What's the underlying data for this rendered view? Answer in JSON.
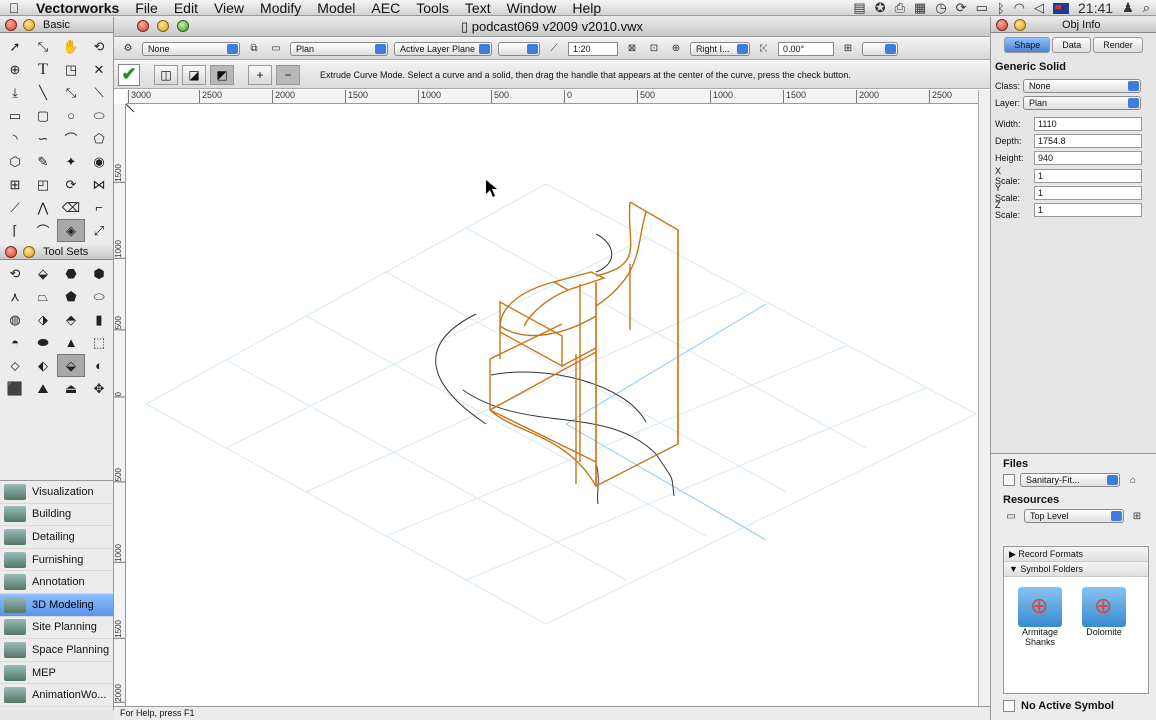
{
  "menubar": {
    "app_name": "Vectorworks",
    "menus": [
      "File",
      "Edit",
      "View",
      "Modify",
      "Model",
      "AEC",
      "Tools",
      "Text",
      "Window",
      "Help"
    ],
    "clock": "21:41"
  },
  "basic_palette": {
    "title": "Basic"
  },
  "toolsets_palette": {
    "title": "Tool Sets"
  },
  "tool_sets": [
    "Visualization",
    "Building",
    "Detailing",
    "Furnishing",
    "Annotation",
    "3D Modeling",
    "Site Planning",
    "Space Planning",
    "MEP",
    "AnimationWo..."
  ],
  "active_tool_set": "3D Modeling",
  "document": {
    "title": "podcast069 v2009 v2010.vwx",
    "class_popup": "None",
    "layer_popup": "Plan",
    "plane_popup": "Active Layer Plane",
    "scale": "1:20",
    "view_popup": "Right I...",
    "angle": "0.00°",
    "mode_hint": "Extrude Curve Mode. Select a curve and a solid, then drag the handle that appears at the center of the curve, press the check button.",
    "status": "For Help, press F1",
    "hruler_labels": [
      "3000",
      "2500",
      "2000",
      "1500",
      "1000",
      "500",
      "0",
      "500",
      "1000",
      "1500",
      "2000",
      "2500"
    ],
    "vruler_labels": [
      "1500",
      "1000",
      "500",
      "0",
      "500",
      "1000",
      "1500",
      "2000"
    ]
  },
  "obj_info": {
    "title": "Obj Info",
    "tabs": [
      "Shape",
      "Data",
      "Render"
    ],
    "object_type": "Generic Solid",
    "class_label": "Class:",
    "class_value": "None",
    "layer_label": "Layer:",
    "layer_value": "Plan",
    "width_label": "Width:",
    "width_value": "1110",
    "depth_label": "Depth:",
    "depth_value": "1754.8",
    "height_label": "Height:",
    "height_value": "940",
    "xscale_label": "X Scale:",
    "xscale_value": "1",
    "yscale_label": "Y Scale:",
    "yscale_value": "1",
    "zscale_label": "Z Scale:",
    "zscale_value": "1"
  },
  "resources_panel": {
    "files_label": "Files",
    "file_popup": "Sanitary-Fit...",
    "resources_label": "Resources",
    "folder_popup": "Top Level",
    "tree": [
      "Record Formats",
      "Symbol Folders"
    ],
    "symbols": [
      "Armitage Shanks",
      "Dolomite"
    ],
    "active_symbol": "No Active Symbol"
  },
  "colors": {
    "model_lines": "#c8741a",
    "grid": "#cfe4f2",
    "axis": "#8ccbf0",
    "highlight": "#5a94e8"
  }
}
